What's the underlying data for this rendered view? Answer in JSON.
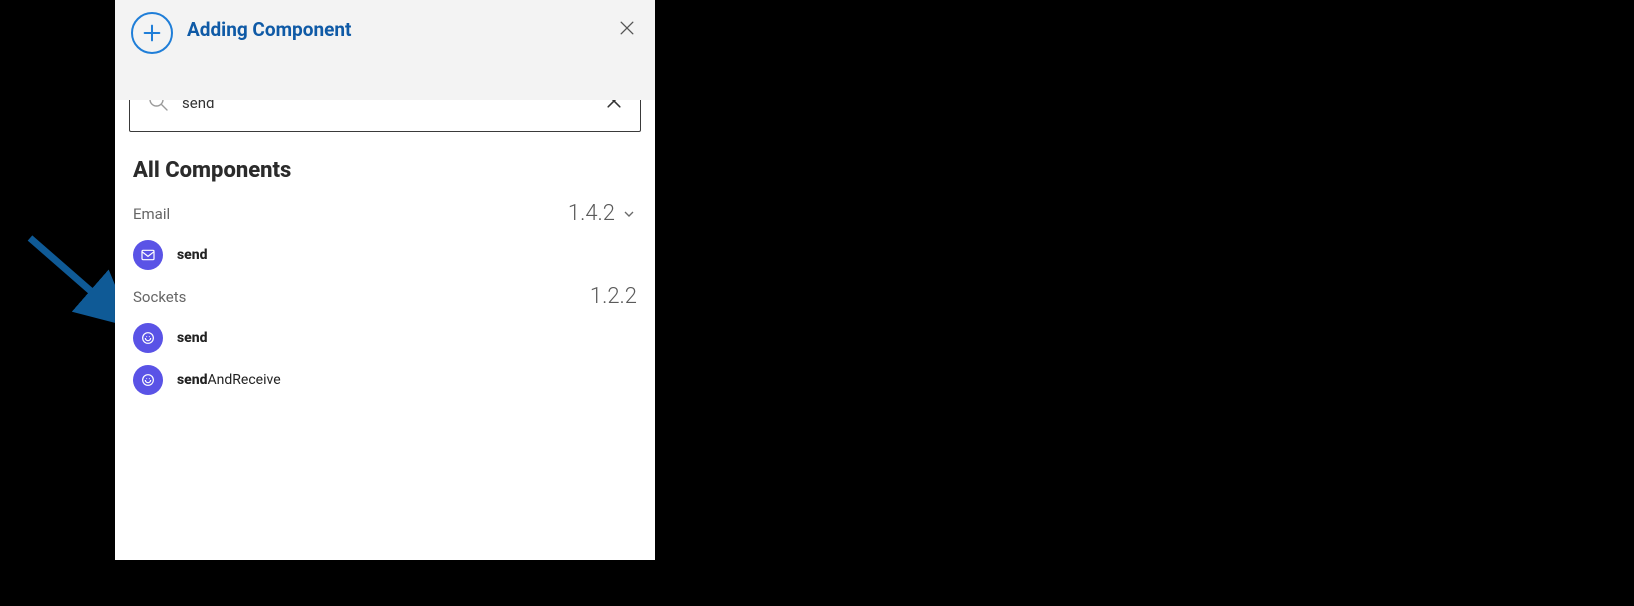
{
  "header": {
    "title": "Adding Component"
  },
  "search": {
    "value": "send"
  },
  "section_title": "All Components",
  "groups": [
    {
      "name": "Email",
      "version": "1.4.2",
      "has_dropdown": true,
      "items": [
        {
          "icon": "envelope-icon",
          "match": "send",
          "rest": ""
        }
      ]
    },
    {
      "name": "Sockets",
      "version": "1.2.2",
      "has_dropdown": false,
      "items": [
        {
          "icon": "socket-icon",
          "match": "send",
          "rest": ""
        },
        {
          "icon": "socket-icon",
          "match": "send",
          "rest": "AndReceive"
        }
      ]
    }
  ],
  "colors": {
    "accent": "#1f7ed8",
    "item_icon_bg": "#5a53e6",
    "arrow": "#0f5a96"
  }
}
